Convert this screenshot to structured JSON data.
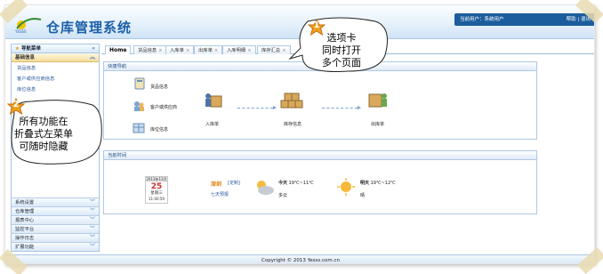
{
  "header": {
    "logo_small_text": "YESSS",
    "title": "仓库管理系统",
    "topbar_left": "当前用户：系统用户",
    "topbar_right": "帮助 | 退出"
  },
  "sidebar": {
    "head_label": "导航菜单",
    "open_group": "基础信息",
    "items": [
      "货品信息",
      "客户或供应商信息",
      "库位信息"
    ],
    "collapsed_groups": [
      "系统设置",
      "仓库管理",
      "报表中心",
      "监控平台",
      "操作日志",
      "扩展功能"
    ]
  },
  "tabs": [
    {
      "label": "Home"
    },
    {
      "label": "货品信息"
    },
    {
      "label": "入库单"
    },
    {
      "label": "出库单"
    },
    {
      "label": "入库明细"
    },
    {
      "label": "库存汇总"
    }
  ],
  "quick_nav": {
    "title": "快捷导航",
    "items": {
      "goods": "货品信息",
      "supplier": "客户或供应商",
      "location": "库位信息",
      "inbound": "入库单",
      "stock": "库存信息",
      "outbound": "出库单"
    }
  },
  "time_panel": {
    "title": "当前时间",
    "cal_month": "2013年12月",
    "cal_day": "25",
    "cal_weekday": "星期三",
    "cal_time": "11:00:59",
    "city": "深圳",
    "city_action": "[定制]",
    "forecast_link": "七天预报",
    "today_label": "今天",
    "today_temp": "19℃~11℃",
    "today_desc": "多云",
    "tomorrow_label": "明天",
    "tomorrow_temp": "19℃~12℃",
    "tomorrow_desc": "晴"
  },
  "footer": {
    "copyright": "Copyright © 2013 Yesss.com.cn"
  },
  "callouts": {
    "one": {
      "number": "1",
      "lines": [
        "选项卡",
        "同时打开",
        "多个页面"
      ]
    },
    "two": {
      "number": "2",
      "lines": [
        "所有功能在",
        "折叠式左菜单",
        "可随时隐藏"
      ]
    }
  }
}
